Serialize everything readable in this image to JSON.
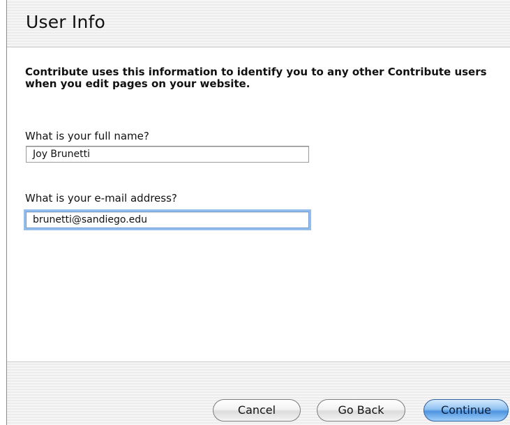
{
  "window": {
    "title": "User Info"
  },
  "intro_text": "Contribute uses this information to identify you to any other Contribute users when you edit pages on your website.",
  "fields": {
    "full_name": {
      "label": "What is your full name?",
      "value": "Joy Brunetti"
    },
    "email": {
      "label": "What is your e-mail address?",
      "value": "brunetti@sandiego.edu"
    }
  },
  "buttons": {
    "cancel": "Cancel",
    "go_back": "Go Back",
    "continue": "Continue"
  },
  "colors": {
    "focus_ring": "#93bdea",
    "primary_button": "#4d93df"
  }
}
